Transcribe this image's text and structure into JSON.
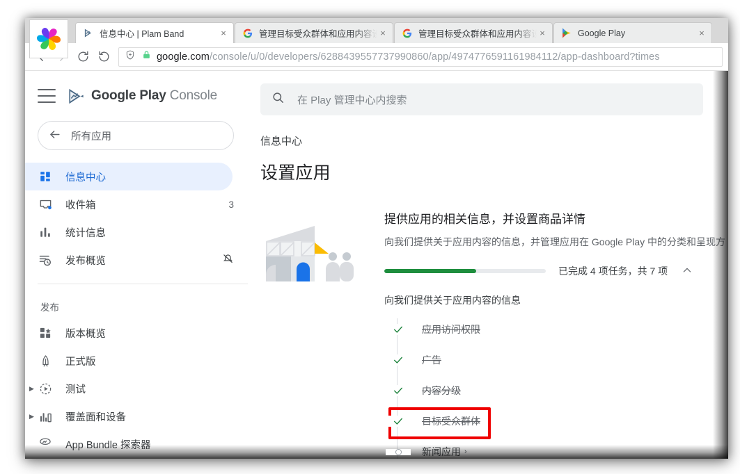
{
  "browser": {
    "logo_icon": "pinwheel-browser-logo",
    "tabs": [
      {
        "title": "信息中心 | Plam Band",
        "favicon": "play-console-favicon",
        "active": true,
        "close_label": "×"
      },
      {
        "title": "管理目标受众群体和应用内容设",
        "favicon": "google-favicon",
        "active": false,
        "close_label": "×"
      },
      {
        "title": "管理目标受众群体和应用内容设",
        "favicon": "google-favicon",
        "active": false,
        "close_label": "×"
      },
      {
        "title": "Google Play",
        "favicon": "google-play-favicon",
        "active": false,
        "close_label": "×"
      }
    ],
    "toolbar": {
      "back_icon": "back-arrow-icon",
      "forward_icon": "forward-arrow-icon",
      "reload_icon": "reload-icon",
      "history_icon": "undo-history-icon",
      "shield_icon": "shield-icon",
      "lock_icon": "lock-icon",
      "url_host": "google.com",
      "url_path": "/console/u/0/developers/6288439557737990860/app/4974776591161984112/app-dashboard?times"
    }
  },
  "sidebar": {
    "hamburger_icon": "hamburger-menu-icon",
    "brand": {
      "icon": "google-play-console-logo",
      "bold_text": "Google Play",
      "light_text": "Console"
    },
    "all_apps": {
      "icon": "back-arrow-icon",
      "label": "所有应用"
    },
    "items": [
      {
        "icon": "dashboard-icon",
        "label": "信息中心",
        "trailing": "",
        "selected": true,
        "expandable": false
      },
      {
        "icon": "inbox-icon",
        "label": "收件箱",
        "trailing": "3",
        "selected": false,
        "expandable": false
      },
      {
        "icon": "statistics-icon",
        "label": "统计信息",
        "trailing": "",
        "selected": false,
        "expandable": false
      },
      {
        "icon": "publishing-overview-icon",
        "label": "发布概览",
        "trailing_icon": "notifications-off-icon",
        "trailing": "",
        "selected": false,
        "expandable": false
      }
    ],
    "section_title": "发布",
    "publish_items": [
      {
        "icon": "release-overview-icon",
        "label": "版本概览",
        "expandable": false
      },
      {
        "icon": "production-rocket-icon",
        "label": "正式版",
        "expandable": false
      },
      {
        "icon": "testing-icon",
        "label": "测试",
        "expandable": true
      },
      {
        "icon": "reach-devices-icon",
        "label": "覆盖面和设备",
        "expandable": true
      },
      {
        "icon": "app-bundle-explorer-icon",
        "label": "App Bundle 探索器",
        "expandable": false
      }
    ]
  },
  "main": {
    "search": {
      "icon": "search-icon",
      "placeholder": "在 Play 管理中心内搜索",
      "value": ""
    },
    "breadcrumb": "信息中心",
    "page_title": "设置应用",
    "illustration_name": "storefront-illustration",
    "card": {
      "heading": "提供应用的相关信息，并设置商品详情",
      "subtitle": "向我们提供关于应用内容的信息，并管理应用在 Google Play 中的分类和呈现方",
      "progress": {
        "percent": 57,
        "fill_color": "#1e8e3e",
        "track_color": "#e8eaed",
        "text": "已完成 4 项任务，共 7 项",
        "collapse_icon": "chevron-up-icon"
      },
      "task_group_label": "向我们提供关于应用内容的信息",
      "tasks": [
        {
          "label": "应用访问权限",
          "state": "done",
          "mark_icon": "check-icon",
          "chevron": "",
          "highlighted": false
        },
        {
          "label": "广告",
          "state": "done",
          "mark_icon": "check-icon",
          "chevron": "",
          "highlighted": false
        },
        {
          "label": "内容分级",
          "state": "done",
          "mark_icon": "check-icon",
          "chevron": "",
          "highlighted": false
        },
        {
          "label": "目标受众群体",
          "state": "done",
          "mark_icon": "check-icon",
          "chevron": "",
          "highlighted": true
        },
        {
          "label": "新闻应用",
          "state": "todo",
          "mark_icon": "circle-icon",
          "chevron": "›",
          "highlighted": false
        }
      ]
    }
  },
  "colors": {
    "accent_blue": "#1a73e8",
    "selected_bg": "#e8f0fe",
    "progress_green": "#1e8e3e",
    "highlight_red": "#ef0000"
  }
}
